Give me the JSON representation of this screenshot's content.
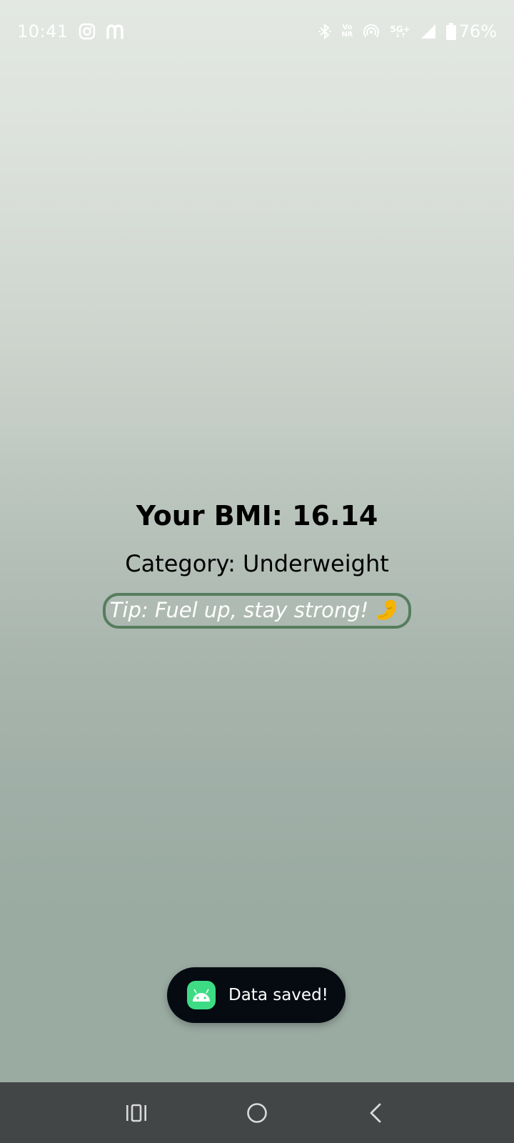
{
  "status_bar": {
    "time": "10:41",
    "left_icons": [
      "instagram-icon",
      "meesho-icon"
    ],
    "right_icons": [
      "bluetooth-icon",
      "vonr-icon",
      "hotspot-icon",
      "5g-plus-icon",
      "signal-icon",
      "battery-icon"
    ],
    "vonr_label_top": "Vo",
    "vonr_label_bottom": "NR",
    "network_label": "5G+",
    "battery_percent": "76%"
  },
  "result": {
    "bmi_label": "Your BMI: 16.14",
    "category_label": "Category: Underweight",
    "tip_text": "Tip: Fuel up, stay strong!",
    "tip_emoji": "flexed-biceps-icon"
  },
  "toast": {
    "app_icon": "android-icon",
    "message": "Data saved!"
  },
  "navigation": {
    "buttons": [
      "recents-icon",
      "home-icon",
      "back-icon"
    ]
  },
  "colors": {
    "tip_border": "#567d5e",
    "toast_bg": "#060b12",
    "nav_bg": "#434646",
    "android_green": "#3ddc84"
  }
}
